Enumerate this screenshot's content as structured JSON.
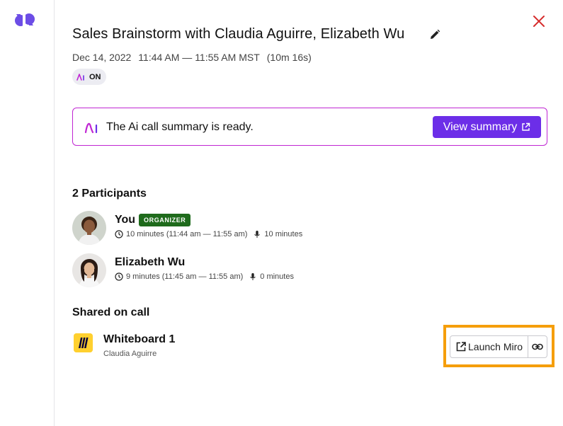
{
  "header": {
    "title": "Sales Brainstorm with Claudia Aguirre, Elizabeth Wu",
    "date": "Dec 14, 2022",
    "time_range": "11:44 AM — 11:55 AM MST",
    "duration": "(10m 16s)",
    "ai_toggle_label": "ON"
  },
  "banner": {
    "message": "The Ai call summary is ready.",
    "button_label": "View summary"
  },
  "participants": {
    "heading": "2 Participants",
    "items": [
      {
        "name": "You",
        "badge": "ORGANIZER",
        "time": "10 minutes (11:44 am — 11:55 am)",
        "talk_time": "10 minutes"
      },
      {
        "name": "Elizabeth Wu",
        "time": "9 minutes (11:45 am — 11:55 am)",
        "talk_time": "0 minutes"
      }
    ]
  },
  "shared": {
    "heading": "Shared on call",
    "item": {
      "title": "Whiteboard 1",
      "owner": "Claudia Aguirre",
      "launch_label": "Launch Miro"
    }
  },
  "colors": {
    "accent_purple": "#6c2ee8",
    "banner_border": "#c026d3",
    "organizer_badge": "#1f6b1c",
    "close_red": "#d62c2c",
    "miro_yellow": "#ffd02f",
    "highlight_orange": "#f59e0b"
  },
  "icons": [
    "app-logo-icon",
    "close-icon",
    "edit-pencil-icon",
    "ai-icon",
    "external-link-icon",
    "clock-icon",
    "microphone-icon",
    "miro-icon",
    "link-icon"
  ]
}
